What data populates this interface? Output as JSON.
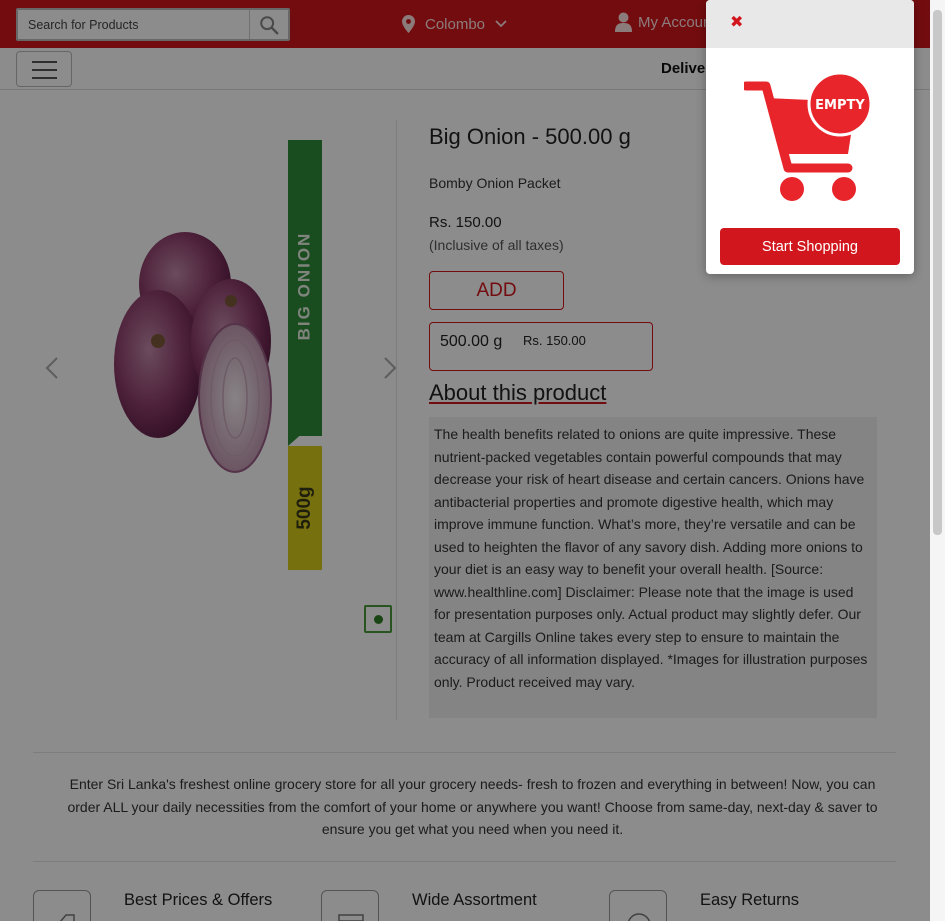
{
  "header": {
    "search": {
      "placeholder": "Search for Products"
    },
    "location": "Colombo",
    "account": "My Account"
  },
  "subbar": {
    "delivery_text": "Deliver"
  },
  "product": {
    "title": "Big Onion - 500.00 g",
    "description": "Bomby Onion Packet",
    "price": "Rs. 150.00",
    "tax_note": "(Inclusive of all taxes)",
    "add_label": "ADD",
    "variant": {
      "weight": "500.00 g",
      "price": "Rs. 150.00"
    },
    "package_text": {
      "name": "BIG ONION",
      "weight": "500g"
    },
    "about_heading": "About this product",
    "about_text": "The health benefits related to onions are quite impressive. These nutrient-packed vegetables contain powerful compounds that may decrease your risk of heart disease and certain cancers. Onions have antibacterial properties and promote digestive health, which may improve immune function. What’s more, they’re versatile and can be used to heighten the flavor of any savory dish. Adding more onions to your diet is an easy way to benefit your overall health. [Source: www.healthline.com] Disclaimer: Please note that the image is used for presentation purposes only. Actual product may slightly defer. Our team at Cargills Online takes every step to ensure to maintain the accuracy of all information displayed. *Images for illustration purposes only. Product received may vary."
  },
  "intro_text": "Enter Sri Lanka's freshest online grocery store for all your grocery needs- fresh to frozen and everything in between! Now, you can order ALL your daily necessities from the comfort of your home or anywhere you want! Choose from same-day, next-day & saver to ensure you get what you need when you need it.",
  "features": [
    {
      "title": "Best Prices & Offers",
      "icon": "tag-icon"
    },
    {
      "title": "Wide Assortment",
      "icon": "box-icon"
    },
    {
      "title": "Easy Returns",
      "icon": "rupee-icon"
    }
  ],
  "cart_popup": {
    "close_icon": "close-icon",
    "empty_badge": "EMPTY",
    "button_label": "Start Shopping"
  },
  "colors": {
    "brand_red": "#d2161d",
    "package_green": "#2e8b3a",
    "package_yellow": "#d9cc1a"
  }
}
